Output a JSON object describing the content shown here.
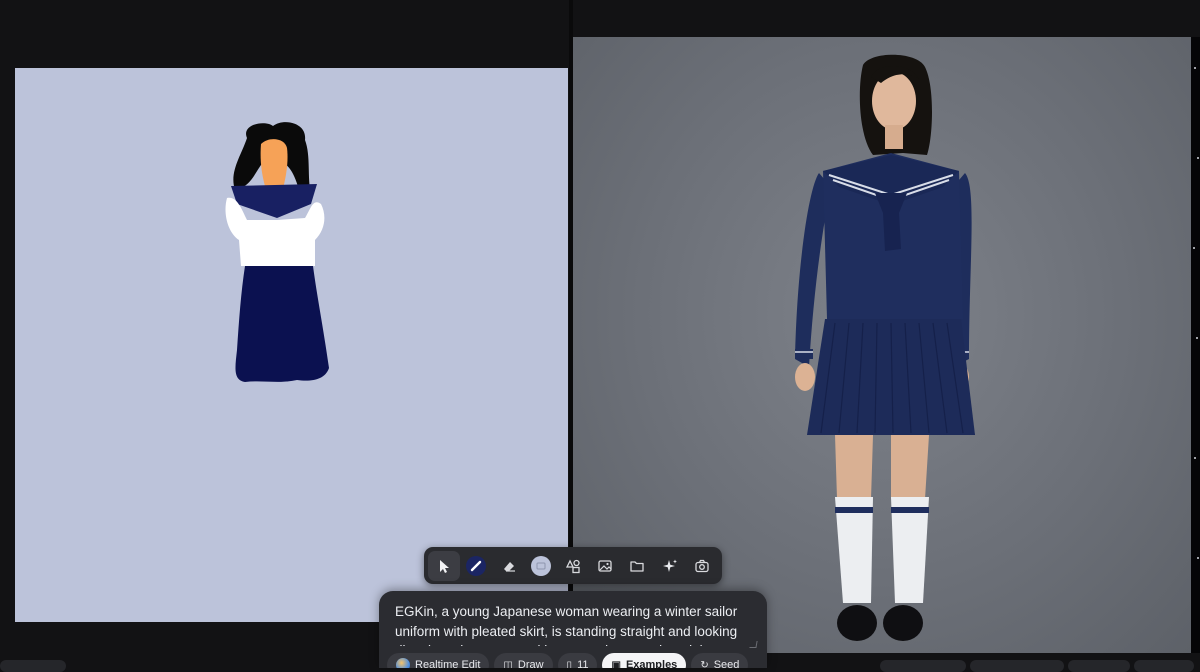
{
  "toolbar": {
    "tools": [
      {
        "name": "select-tool",
        "icon": "cursor-icon",
        "active": true
      },
      {
        "name": "brush-tool",
        "icon": "brush-icon",
        "color": "#1b2563"
      },
      {
        "name": "eraser-tool",
        "icon": "eraser-icon"
      },
      {
        "name": "color-swatch",
        "icon": "color-swatch-icon",
        "color": "#bcc3da"
      },
      {
        "name": "shapes-tool",
        "icon": "shapes-icon"
      },
      {
        "name": "image-tool",
        "icon": "image-icon"
      },
      {
        "name": "folder-tool",
        "icon": "folder-icon"
      },
      {
        "name": "sparkle-tool",
        "icon": "sparkle-icon"
      },
      {
        "name": "camera-tool",
        "icon": "camera-icon"
      }
    ]
  },
  "prompt": {
    "text": "EGKin, a young Japanese woman wearing a winter sailor uniform with pleated skirt, is standing straight and looking directly at the camera with a neutral expression, doing"
  },
  "pills": [
    {
      "id": "realtime",
      "icon": "globe-icon",
      "label": "Realtime Edit"
    },
    {
      "id": "draw",
      "icon": "draw-icon",
      "label": "Draw"
    },
    {
      "id": "count",
      "icon": "phone-icon",
      "label": "11"
    },
    {
      "id": "examples",
      "icon": "examples-icon",
      "label": "Examples"
    },
    {
      "id": "seed",
      "icon": "seed-icon",
      "label": "Seed"
    }
  ],
  "colors": {
    "canvas_bg": "#bcc3da",
    "uniform_navy": "#1f2d5a",
    "skirt_navy": "#0b1150",
    "skin_orange": "#f4a55a"
  }
}
